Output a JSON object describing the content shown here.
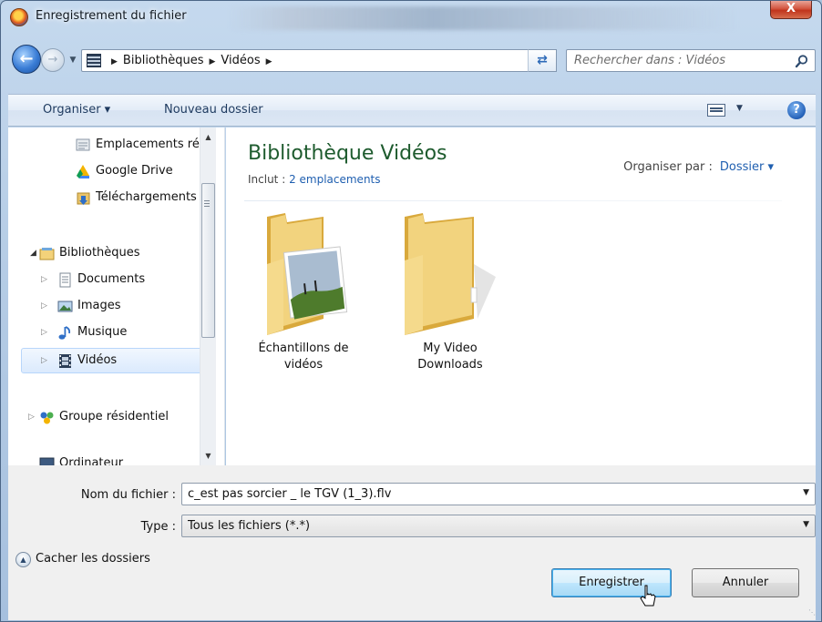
{
  "window": {
    "title": "Enregistrement du fichier",
    "close_label": "X"
  },
  "address": {
    "crumbs": [
      "Bibliothèques",
      "Vidéos"
    ],
    "search_placeholder": "Rechercher dans : Vidéos"
  },
  "toolbar": {
    "organize_label": "Organiser ▾",
    "new_folder_label": "Nouveau dossier",
    "help_label": "?"
  },
  "nav": {
    "items": [
      {
        "label": "Emplacements ré",
        "icon": "recent-places-icon"
      },
      {
        "label": "Google Drive",
        "icon": "google-drive-icon"
      },
      {
        "label": "Téléchargements",
        "icon": "downloads-icon"
      },
      {
        "label": "Bibliothèques",
        "icon": "libraries-icon"
      },
      {
        "label": "Documents",
        "icon": "documents-icon"
      },
      {
        "label": "Images",
        "icon": "pictures-icon"
      },
      {
        "label": "Musique",
        "icon": "music-icon"
      },
      {
        "label": "Vidéos",
        "icon": "videos-icon"
      },
      {
        "label": "Groupe résidentiel",
        "icon": "homegroup-icon"
      },
      {
        "label": "Ordinateur",
        "icon": "computer-icon"
      }
    ]
  },
  "content": {
    "title": "Bibliothèque Vidéos",
    "includes_prefix": "Inclut : ",
    "includes_link": "2 emplacements",
    "arrange_label": "Organiser par :",
    "arrange_value": "Dossier ▾",
    "folders": [
      {
        "line1": "Échantillons de",
        "line2": "vidéos"
      },
      {
        "line1": "My Video",
        "line2": "Downloads"
      }
    ]
  },
  "form": {
    "filename_label": "Nom du fichier :",
    "filename_value": "c_est pas sorcier _ le TGV (1_3).flv",
    "type_label": "Type :",
    "type_value": "Tous les fichiers (*.*)"
  },
  "footer": {
    "hide_folders_label": "Cacher les dossiers",
    "save_label": "Enregistrer",
    "cancel_label": "Annuler"
  },
  "colors": {
    "library_title": "#1e5b2e",
    "link": "#1f5fb0",
    "selection": "#dbeafd"
  }
}
